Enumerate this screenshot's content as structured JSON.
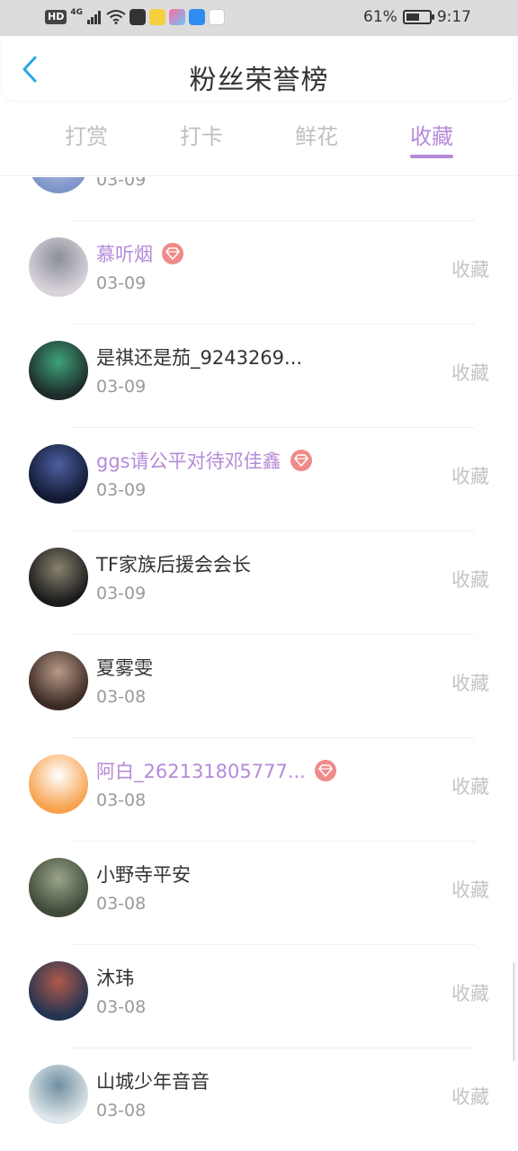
{
  "status_bar": {
    "hd": "HD",
    "network": "4G",
    "battery_percent": "61%",
    "battery_level": 0.61,
    "time": "9:17"
  },
  "header": {
    "title": "粉丝荣誉榜"
  },
  "tabs": [
    {
      "label": "打赏",
      "active": false
    },
    {
      "label": "打卡",
      "active": false
    },
    {
      "label": "鲜花",
      "active": false
    },
    {
      "label": "收藏",
      "active": true
    }
  ],
  "fans": [
    {
      "name": "",
      "date": "03-09",
      "action": "",
      "vip": false
    },
    {
      "name": "慕听烟",
      "date": "03-09",
      "action": "收藏",
      "vip": true
    },
    {
      "name": "是祺还是茄_9243269...",
      "date": "03-09",
      "action": "收藏",
      "vip": false
    },
    {
      "name": "ggs请公平对待邓佳鑫",
      "date": "03-09",
      "action": "收藏",
      "vip": true
    },
    {
      "name": "TF家族后援会会长",
      "date": "03-09",
      "action": "收藏",
      "vip": false
    },
    {
      "name": "夏雾雯",
      "date": "03-08",
      "action": "收藏",
      "vip": false
    },
    {
      "name": "阿白_262131805777...",
      "date": "03-08",
      "action": "收藏",
      "vip": true
    },
    {
      "name": "小野寺平安",
      "date": "03-08",
      "action": "收藏",
      "vip": false
    },
    {
      "name": "沐玮",
      "date": "03-08",
      "action": "收藏",
      "vip": false
    },
    {
      "name": "山城少年音音",
      "date": "03-08",
      "action": "收藏",
      "vip": false
    }
  ],
  "colors": {
    "accent": "#b68ad8",
    "vip_badge": "#f08a8a",
    "back_arrow": "#2aa7e6"
  },
  "icons": {
    "back": "chevron-left-icon",
    "vip": "diamond-icon"
  }
}
